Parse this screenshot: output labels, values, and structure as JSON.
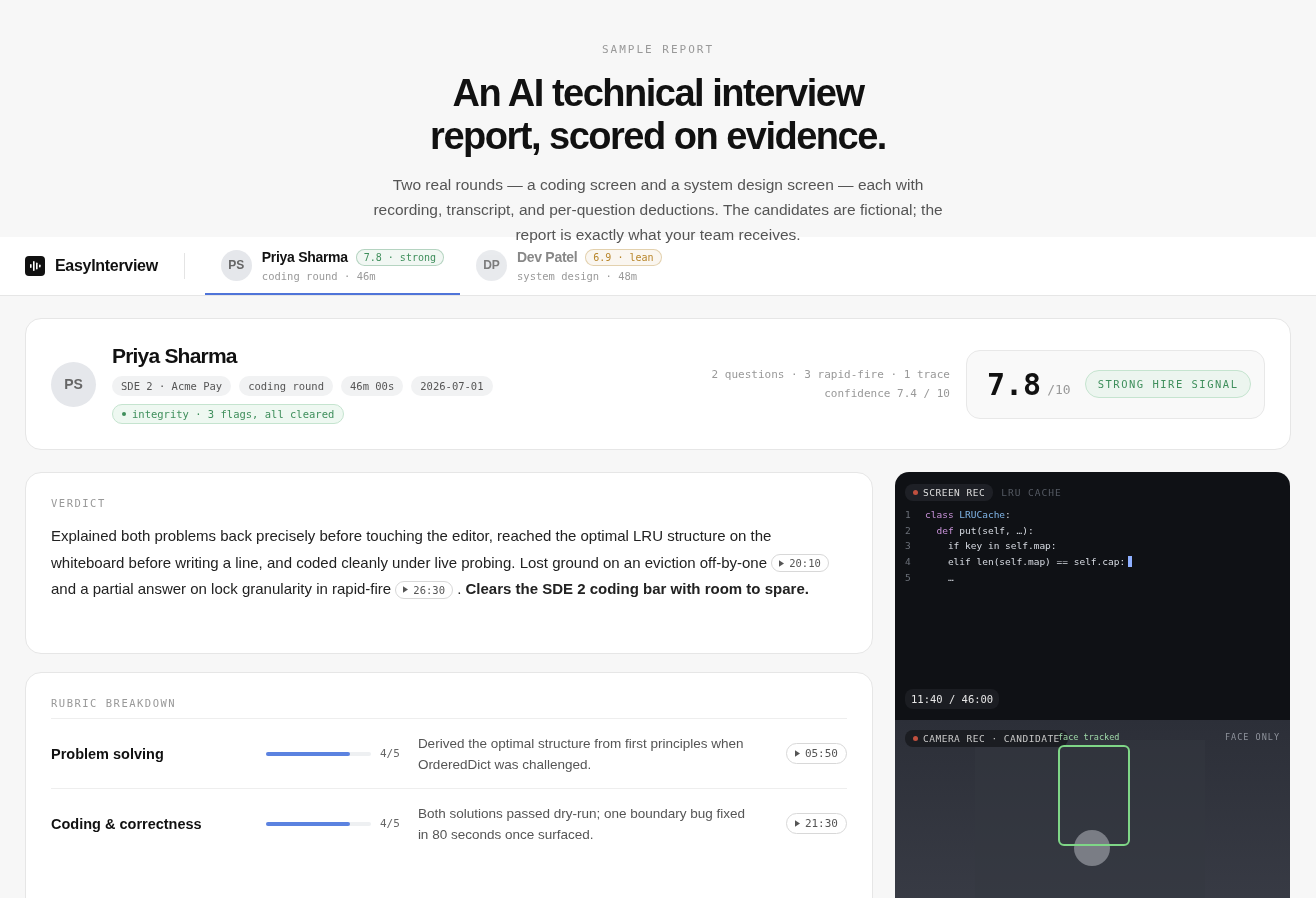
{
  "hero": {
    "eyebrow": "SAMPLE REPORT",
    "title_lines": [
      "An AI technical interview",
      "report, scored on evidence."
    ],
    "lede": "Two real rounds — a coding screen and a system design screen — each with recording, transcript, and per-question deductions. The candidates are fictional; the report is exactly what your team receives."
  },
  "nav": {
    "brand": "EasyInterview",
    "tabs": [
      {
        "initials": "PS",
        "name": "Priya Sharma",
        "badge": "7.8 · strong",
        "color": "#3f8f5c",
        "meta": "coding round · 46m",
        "selected": true
      },
      {
        "initials": "DP",
        "name": "Dev Patel",
        "badge": "6.9 · lean",
        "color": "#b8862b",
        "meta": "system design · 48m",
        "selected": false
      }
    ]
  },
  "candidate": {
    "initials": "PS",
    "name": "Priya Sharma",
    "tags": [
      "SDE 2 · Acme Pay",
      "coding round",
      "46m 00s",
      "2026-07-01"
    ],
    "integrity": "integrity · 3 flags, all cleared",
    "stats": [
      "2 questions · 3 rapid-fire · 1 trace",
      "confidence 7.4 / 10"
    ],
    "score": "7.8",
    "score_max": "/10",
    "signal": "STRONG HIRE SIGNAL"
  },
  "verdict": {
    "heading": "VERDICT",
    "segments": [
      {
        "kind": "text",
        "text": "Explained both problems back precisely before touching the editor, reached the optimal LRU structure on the whiteboard before writing a line, and coded cleanly under live probing. Lost ground on an eviction off-by-one"
      },
      {
        "kind": "time",
        "text": "20:10"
      },
      {
        "kind": "text",
        "text": "and a partial answer on lock granularity in rapid-fire"
      },
      {
        "kind": "time",
        "text": "26:30"
      },
      {
        "kind": "text",
        "text": ". **Clears the SDE 2 coding bar with room to spare.**"
      }
    ]
  },
  "rubric": {
    "heading": "RUBRIC BREAKDOWN",
    "rows": [
      {
        "name": "Problem solving",
        "level": 0.8,
        "score": "4/5",
        "note": "Derived the optimal structure from first principles when OrderedDict was challenged.",
        "time": "05:50"
      },
      {
        "name": "Coding & correctness",
        "level": 0.8,
        "score": "4/5",
        "note": "Both solutions passed dry-run; one boundary bug fixed in 80 seconds once surfaced.",
        "time": "21:30"
      }
    ]
  },
  "screen_rec": {
    "label": "SCREEN REC",
    "title": "LRU CACHE",
    "timecode": "11:40 / 46:00",
    "code": [
      {
        "number": "1",
        "cursor": false,
        "tokens": [
          {
            "kind": "keyword",
            "text": "class "
          },
          {
            "kind": "type",
            "text": "LRUCache"
          },
          {
            "kind": "plain",
            "text": ":"
          }
        ]
      },
      {
        "number": "2",
        "cursor": false,
        "tokens": [
          {
            "kind": "keyword",
            "text": "  def "
          },
          {
            "kind": "plain",
            "text": "put(self, …):"
          }
        ]
      },
      {
        "number": "3",
        "cursor": false,
        "tokens": [
          {
            "kind": "plain",
            "text": "    if key in self.map:"
          }
        ]
      },
      {
        "number": "4",
        "cursor": true,
        "tokens": [
          {
            "kind": "plain",
            "text": "    elif len(self.map) == self.cap:"
          }
        ]
      },
      {
        "number": "5",
        "cursor": false,
        "tokens": [
          {
            "kind": "plain",
            "text": "    …"
          }
        ]
      }
    ]
  },
  "camera_rec": {
    "label": "CAMERA REC · CANDIDATE",
    "tracking": "face tracked",
    "mode": "FACE ONLY"
  }
}
